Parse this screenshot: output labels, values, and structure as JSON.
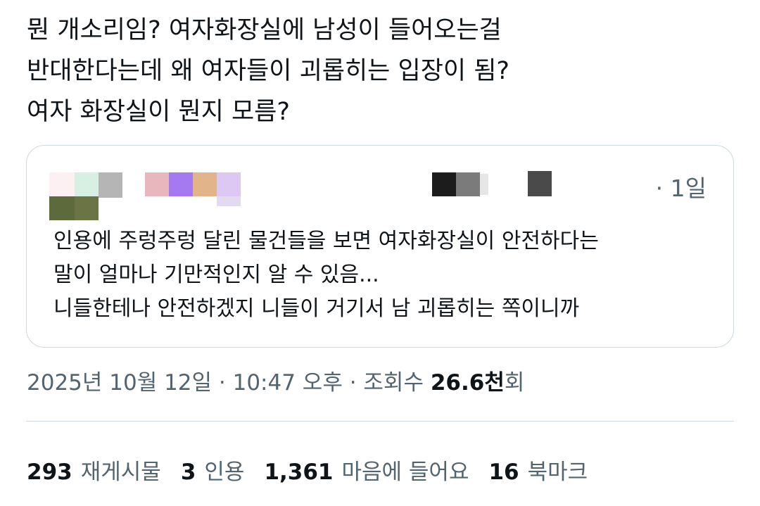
{
  "tweet": {
    "lines": [
      "뭔 개소리임? 여자화장실에 남성이 들어오는걸",
      "반대한다는데 왜 여자들이 괴롭히는 입장이 됨?",
      "여자 화장실이 뭔지 모름?"
    ]
  },
  "quote": {
    "time": "· 1일",
    "body_lines": [
      "인용에 주렁주렁 달린 물건들을 보면 여자화장실이 안전하다는",
      "말이 얼마나 기만적인지 알 수 있음...",
      "니들한테나 안전하겠지 니들이 거기서 남 괴롭히는 쪽이니까"
    ],
    "censor_colors": [
      "#fdf0f3",
      "#d8efe3",
      "#b5b5b5",
      "#5d6a3c",
      "#6b7444",
      "#e8b7bd",
      "#a57af0",
      "#e1b48a",
      "#dcc8f3",
      "#1c1c1c",
      "#7b7b7b",
      "#4a4a4a"
    ]
  },
  "meta": {
    "date": "2025년 10월 12일 · 10:47 오후 · 조회수 ",
    "views_number": "26.6천",
    "views_suffix": "회"
  },
  "stats": {
    "reposts_count": "293",
    "reposts_label": "재게시물",
    "quotes_count": "3",
    "quotes_label": "인용",
    "likes_count": "1,361",
    "likes_label": "마음에 들어요",
    "bookmarks_count": "16",
    "bookmarks_label": "북마크"
  }
}
